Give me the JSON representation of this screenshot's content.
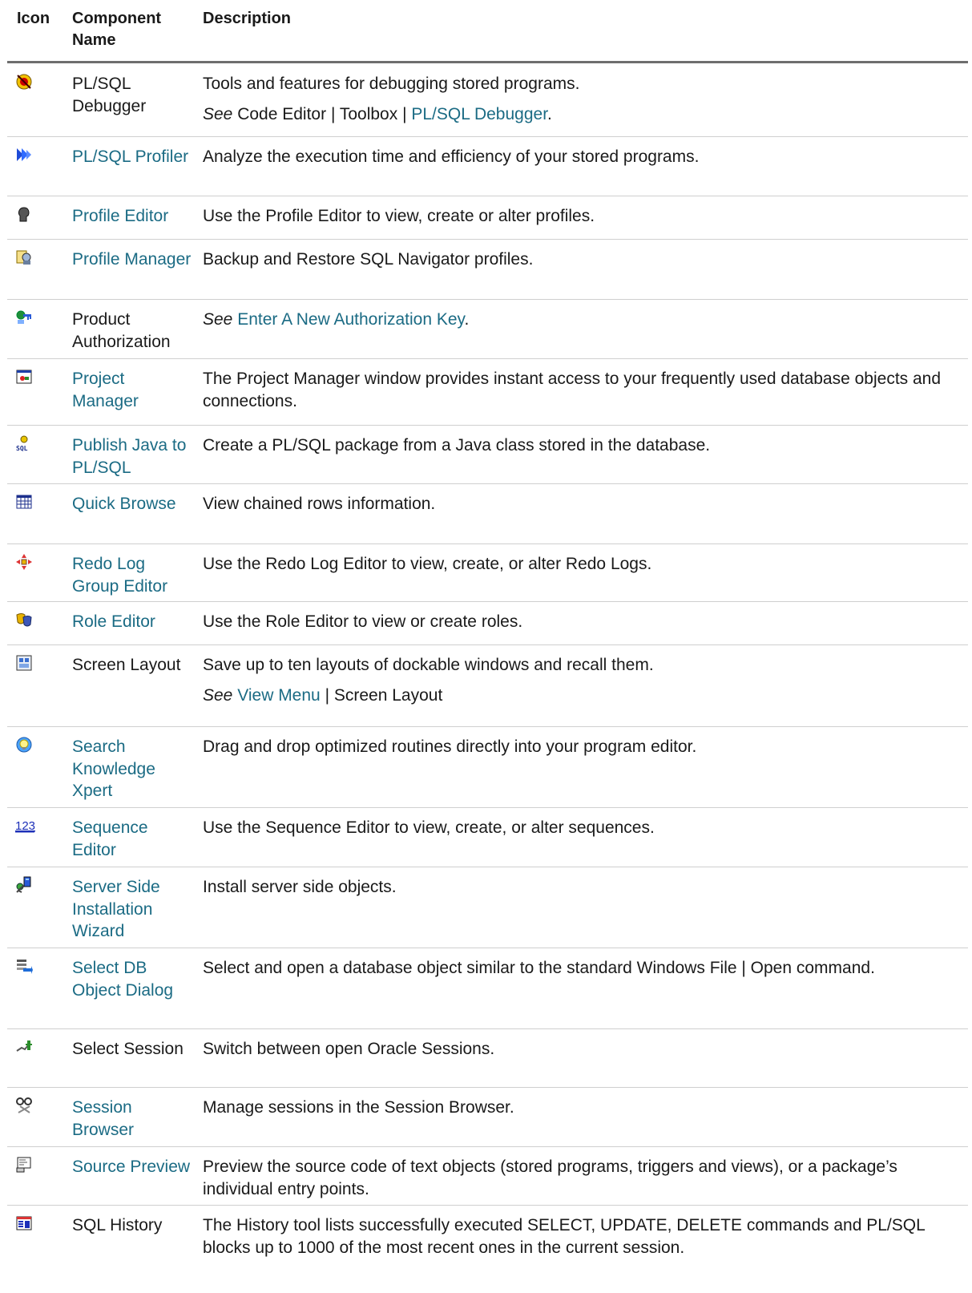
{
  "header": {
    "icon": "Icon",
    "name": "Component Name",
    "description": "Description"
  },
  "rows": [
    {
      "icon": "debugger-icon",
      "name": "PL/SQL Debugger",
      "link": false,
      "desc": "Tools and features for debugging stored programs.",
      "see_prefix": "See",
      "see_text": " Code Editor | Toolbox | ",
      "see_link": "PL/SQL Debugger",
      "see_suffix": "."
    },
    {
      "icon": "profiler-icon",
      "name": "PL/SQL Profiler",
      "link": true,
      "desc": "Analyze the execution time and efficiency of your stored programs."
    },
    {
      "icon": "profile-editor-icon",
      "name": "Profile Editor",
      "link": true,
      "desc": "Use the Profile Editor to view, create or alter profiles."
    },
    {
      "icon": "profile-manager-icon",
      "name": "Profile Manager",
      "link": true,
      "desc": "Backup and Restore SQL Navigator profiles."
    },
    {
      "icon": "key-icon",
      "name": "Product Authorization",
      "link": false,
      "see_prefix": "See",
      "see_link": "Enter A New Authorization Key",
      "see_suffix": "."
    },
    {
      "icon": "project-manager-icon",
      "name": "Project Manager",
      "link": true,
      "desc": "The Project Manager window provides instant access to your frequently used database objects and connections."
    },
    {
      "icon": "publish-java-icon",
      "name": "Publish Java to PL/SQL",
      "link": true,
      "desc": "Create a PL/SQL package from a Java class stored in the database."
    },
    {
      "icon": "grid-icon",
      "name": "Quick Browse",
      "link": true,
      "desc": "View chained rows information."
    },
    {
      "icon": "redo-log-icon",
      "name": "Redo Log Group Editor",
      "link": true,
      "desc": "Use the Redo Log Editor to view, create, or alter Redo Logs."
    },
    {
      "icon": "role-editor-icon",
      "name": "Role Editor",
      "link": true,
      "desc": "Use the Role Editor to view or create roles."
    },
    {
      "icon": "screen-layout-icon",
      "name": "Screen Layout",
      "link": false,
      "desc": "Save up to ten layouts of dockable windows and recall them.",
      "see_prefix": "See",
      "see_link": "View Menu",
      "see_suffix": " | Screen Layout"
    },
    {
      "icon": "lightbulb-icon",
      "name": "Search Knowledge Xpert",
      "link": true,
      "desc": "Drag and drop optimized routines directly into your program editor."
    },
    {
      "icon": "sequence-icon",
      "name": "Sequence Editor",
      "link": true,
      "desc": "Use the Sequence Editor to view, create, or alter sequences."
    },
    {
      "icon": "server-install-icon",
      "name": "Server Side Installation Wizard",
      "link": true,
      "desc": "Install server side objects."
    },
    {
      "icon": "select-db-object-icon",
      "name": "Select DB Object Dialog",
      "link": true,
      "desc": "Select and open a database object similar to the standard Windows File | Open command."
    },
    {
      "icon": "session-icon",
      "name": "Select Session",
      "link": false,
      "desc": "Switch between open Oracle Sessions."
    },
    {
      "icon": "session-browser-icon",
      "name": "Session Browser",
      "link": true,
      "desc": "Manage sessions in the Session Browser."
    },
    {
      "icon": "source-preview-icon",
      "name": "Source Preview",
      "link": true,
      "desc": "Preview the source code of text objects (stored programs, triggers and views), or a package’s individual entry points."
    },
    {
      "icon": "sql-history-icon",
      "name": "SQL History",
      "link": false,
      "desc": "The History tool lists successfully executed SELECT, UPDATE, DELETE commands and PL/SQL blocks up to 1000 of the most recent ones in the current session."
    }
  ]
}
